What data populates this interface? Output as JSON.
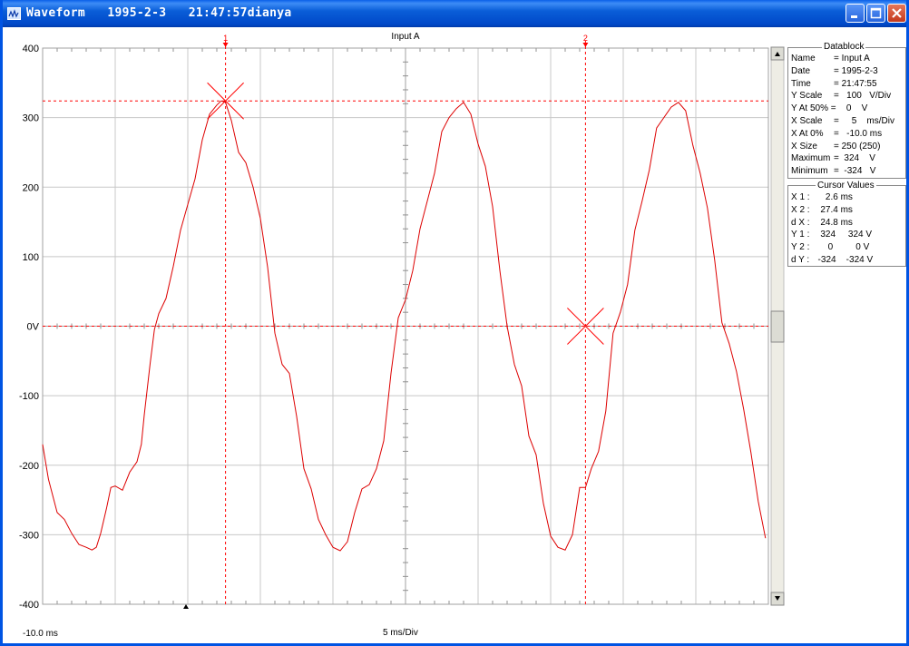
{
  "window": {
    "title": "Waveform   1995-2-3   21:47:57dianya",
    "icon": "waveform-app-icon"
  },
  "titlebar_buttons": [
    {
      "name": "minimize",
      "icon": "minimize-icon"
    },
    {
      "name": "maximize",
      "icon": "maximize-icon"
    },
    {
      "name": "close",
      "icon": "close-icon"
    }
  ],
  "plot": {
    "title": "Input A",
    "y_tick_labels": [
      "400",
      "300",
      "200",
      "100",
      "0V",
      "-100",
      "-200",
      "-300",
      "-400"
    ],
    "x_start_label": "-10.0 ms",
    "x_scale_label": "5 ms/Div",
    "cursor1_label": "1",
    "cursor2_label": "2",
    "trace_color": "#dd0000",
    "cursor_color": "#ff0000",
    "grid_color": "#c8c8c8"
  },
  "chart_data": {
    "type": "line",
    "title": "Input A",
    "xlabel": "5 ms/Div",
    "ylabel": "",
    "xlim": [
      -10,
      40
    ],
    "ylim": [
      -400,
      400
    ],
    "series": [
      {
        "x": [
          -10,
          -9.6,
          -9,
          -8.5,
          -8,
          -7.5,
          -7,
          -6.6,
          -6.3,
          -6,
          -5.6,
          -5.3,
          -5,
          -4.5,
          -4,
          -3.5,
          -3.2,
          -3,
          -2.6,
          -2.3,
          -2,
          -1.5,
          -1,
          -0.5,
          0,
          0.5,
          1,
          1.5,
          2,
          2.3,
          2.6,
          3,
          3.5,
          4,
          4.5,
          5,
          5.5,
          6,
          6.5,
          7,
          7.5,
          8,
          8.5,
          9,
          9.5,
          10,
          10.5,
          11,
          11.5,
          12,
          12.5,
          13,
          13.5,
          14,
          14.5,
          15,
          15.5,
          16,
          16.5,
          17,
          17.5,
          18,
          18.5,
          19,
          19.5,
          20,
          20.5,
          21,
          21.5,
          22,
          22.5,
          23,
          23.5,
          24,
          24.5,
          25,
          25.5,
          26,
          26.5,
          27,
          27.4,
          27.8,
          28.3,
          28.8,
          29.3,
          29.8,
          30.3,
          30.8,
          31.3,
          31.8,
          32.3,
          32.8,
          33.3,
          33.8,
          34.3,
          34.8,
          35.3,
          35.8,
          36.3,
          36.8,
          37.3,
          37.8,
          38.3,
          38.8,
          39.3,
          39.8
        ],
        "y": [
          -170,
          -220,
          -268,
          -278,
          -298,
          -314,
          -318,
          -322,
          -318,
          -298,
          -262,
          -232,
          -230,
          -236,
          -210,
          -195,
          -170,
          -128,
          -55,
          -5,
          18,
          40,
          86,
          138,
          175,
          212,
          268,
          305,
          318,
          324,
          322,
          296,
          250,
          235,
          200,
          155,
          85,
          -10,
          -55,
          -68,
          -130,
          -205,
          -234,
          -278,
          -300,
          -318,
          -323,
          -310,
          -268,
          -234,
          -228,
          -205,
          -165,
          -68,
          12,
          38,
          80,
          140,
          180,
          220,
          280,
          300,
          313,
          322,
          305,
          262,
          230,
          172,
          80,
          0,
          -55,
          -86,
          -158,
          -185,
          -255,
          -302,
          -318,
          -322,
          -300,
          -232,
          -232,
          -205,
          -180,
          -122,
          -10,
          20,
          60,
          138,
          180,
          225,
          285,
          300,
          315,
          322,
          310,
          260,
          220,
          170,
          95,
          5,
          -25,
          -65,
          -120,
          -182,
          -252,
          -305
        ]
      }
    ],
    "cursors": {
      "x1_ms": 2.6,
      "x2_ms": 27.4,
      "y1_v": 324,
      "y2_v": 0
    }
  },
  "datablock": {
    "title": "Datablock",
    "rows": [
      {
        "label": "Name",
        "value": "= Input A"
      },
      {
        "label": "Date",
        "value": "= 1995-2-3"
      },
      {
        "label": "Time",
        "value": "= 21:47:55"
      },
      {
        "label": "Y Scale",
        "value": "=   100   V/Div"
      },
      {
        "label": "Y At 50% =",
        "value": "     0    V"
      },
      {
        "label": "X Scale",
        "value": "=     5    ms/Div"
      },
      {
        "label": "X At 0%",
        "value": "=   -10.0 ms"
      },
      {
        "label": "X Size",
        "value": "= 250 (250)"
      },
      {
        "label": "Maximum",
        "value": "=  324    V"
      },
      {
        "label": "Minimum",
        "value": "=  -324   V"
      }
    ]
  },
  "cursor_values": {
    "title": "Cursor Values",
    "rows": [
      {
        "label": "X 1 :",
        "value": "     2.6 ms"
      },
      {
        "label": "X 2 :",
        "value": "   27.4 ms"
      },
      {
        "label": "d X :",
        "value": "   24.8 ms"
      },
      {
        "label": "Y 1 :",
        "value": "   324     324 V"
      },
      {
        "label": "Y 2 :",
        "value": "      0         0 V"
      },
      {
        "label": "d Y :",
        "value": "  -324    -324 V"
      }
    ]
  },
  "scrollbar": {
    "up_icon": "scroll-up-arrow-icon",
    "down_icon": "scroll-down-arrow-icon"
  }
}
